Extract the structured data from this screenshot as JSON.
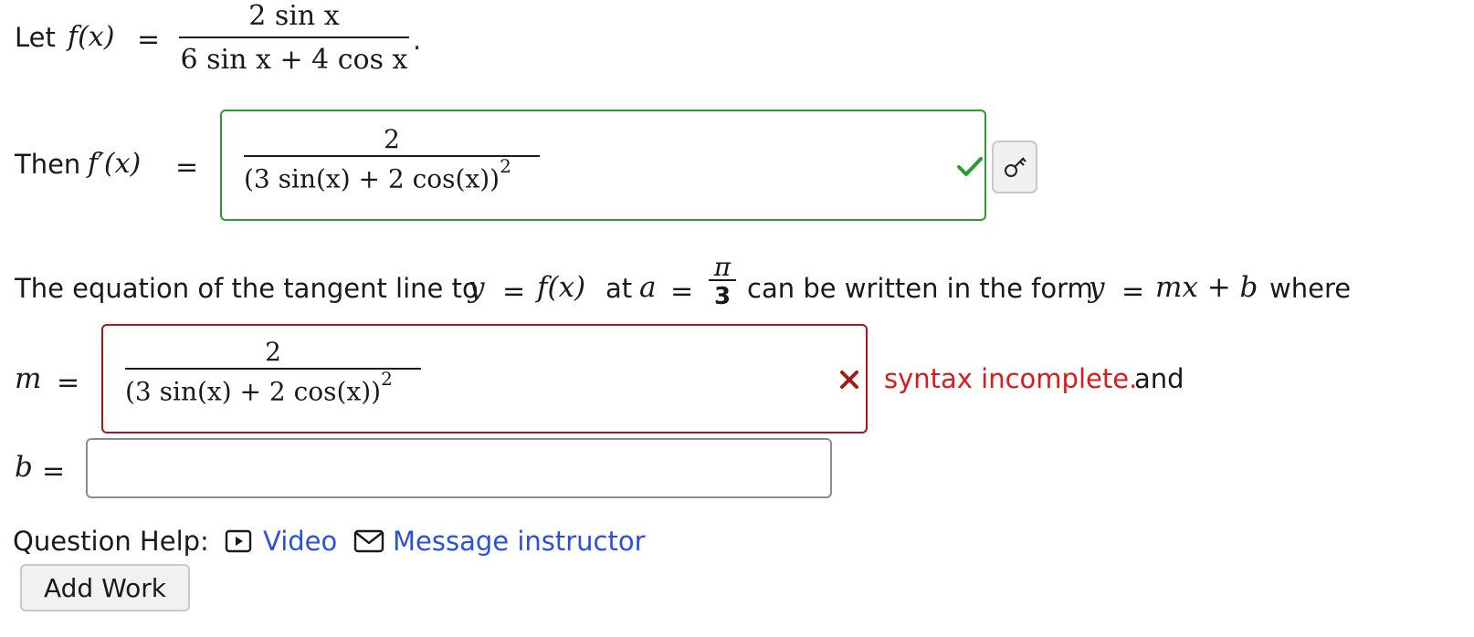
{
  "line1": {
    "prefix": "Let",
    "func": "f(x)",
    "equals": "=",
    "numerator": "2 sin x",
    "denominator": "6 sin x + 4 cos x",
    "period": "."
  },
  "line2": {
    "prefix": "Then",
    "func": "f′(x)",
    "equals": "=",
    "answer": {
      "numerator": "2",
      "denominator": "(3 sin(x) + 2 cos(x))",
      "exponent": "2",
      "status": "correct"
    }
  },
  "line3": {
    "part1": "The equation of the tangent line to",
    "y": "y",
    "eq1": "=",
    "fx": "f(x)",
    "at": "at",
    "a": "a",
    "eq2": "=",
    "pi": "π",
    "three": "3",
    "part2": "can be written in the form",
    "form_y": "y",
    "form_eq": "=",
    "form_rhs": "mx + b",
    "where": "where"
  },
  "m_field": {
    "label": "m",
    "equals": "=",
    "numerator": "2",
    "denominator": "(3 sin(x) + 2 cos(x))",
    "exponent": "2",
    "status": "incorrect",
    "error": "syntax incomplete.",
    "and": "and"
  },
  "b_field": {
    "label": "b",
    "equals": "=",
    "value": ""
  },
  "help": {
    "label": "Question Help:",
    "video": "Video",
    "message": "Message instructor"
  },
  "add_work": "Add Work",
  "colors": {
    "correct": "#2a9c2a",
    "incorrect": "#a31a1a",
    "error_text": "#d81b1b",
    "link": "#2b4fdf"
  }
}
